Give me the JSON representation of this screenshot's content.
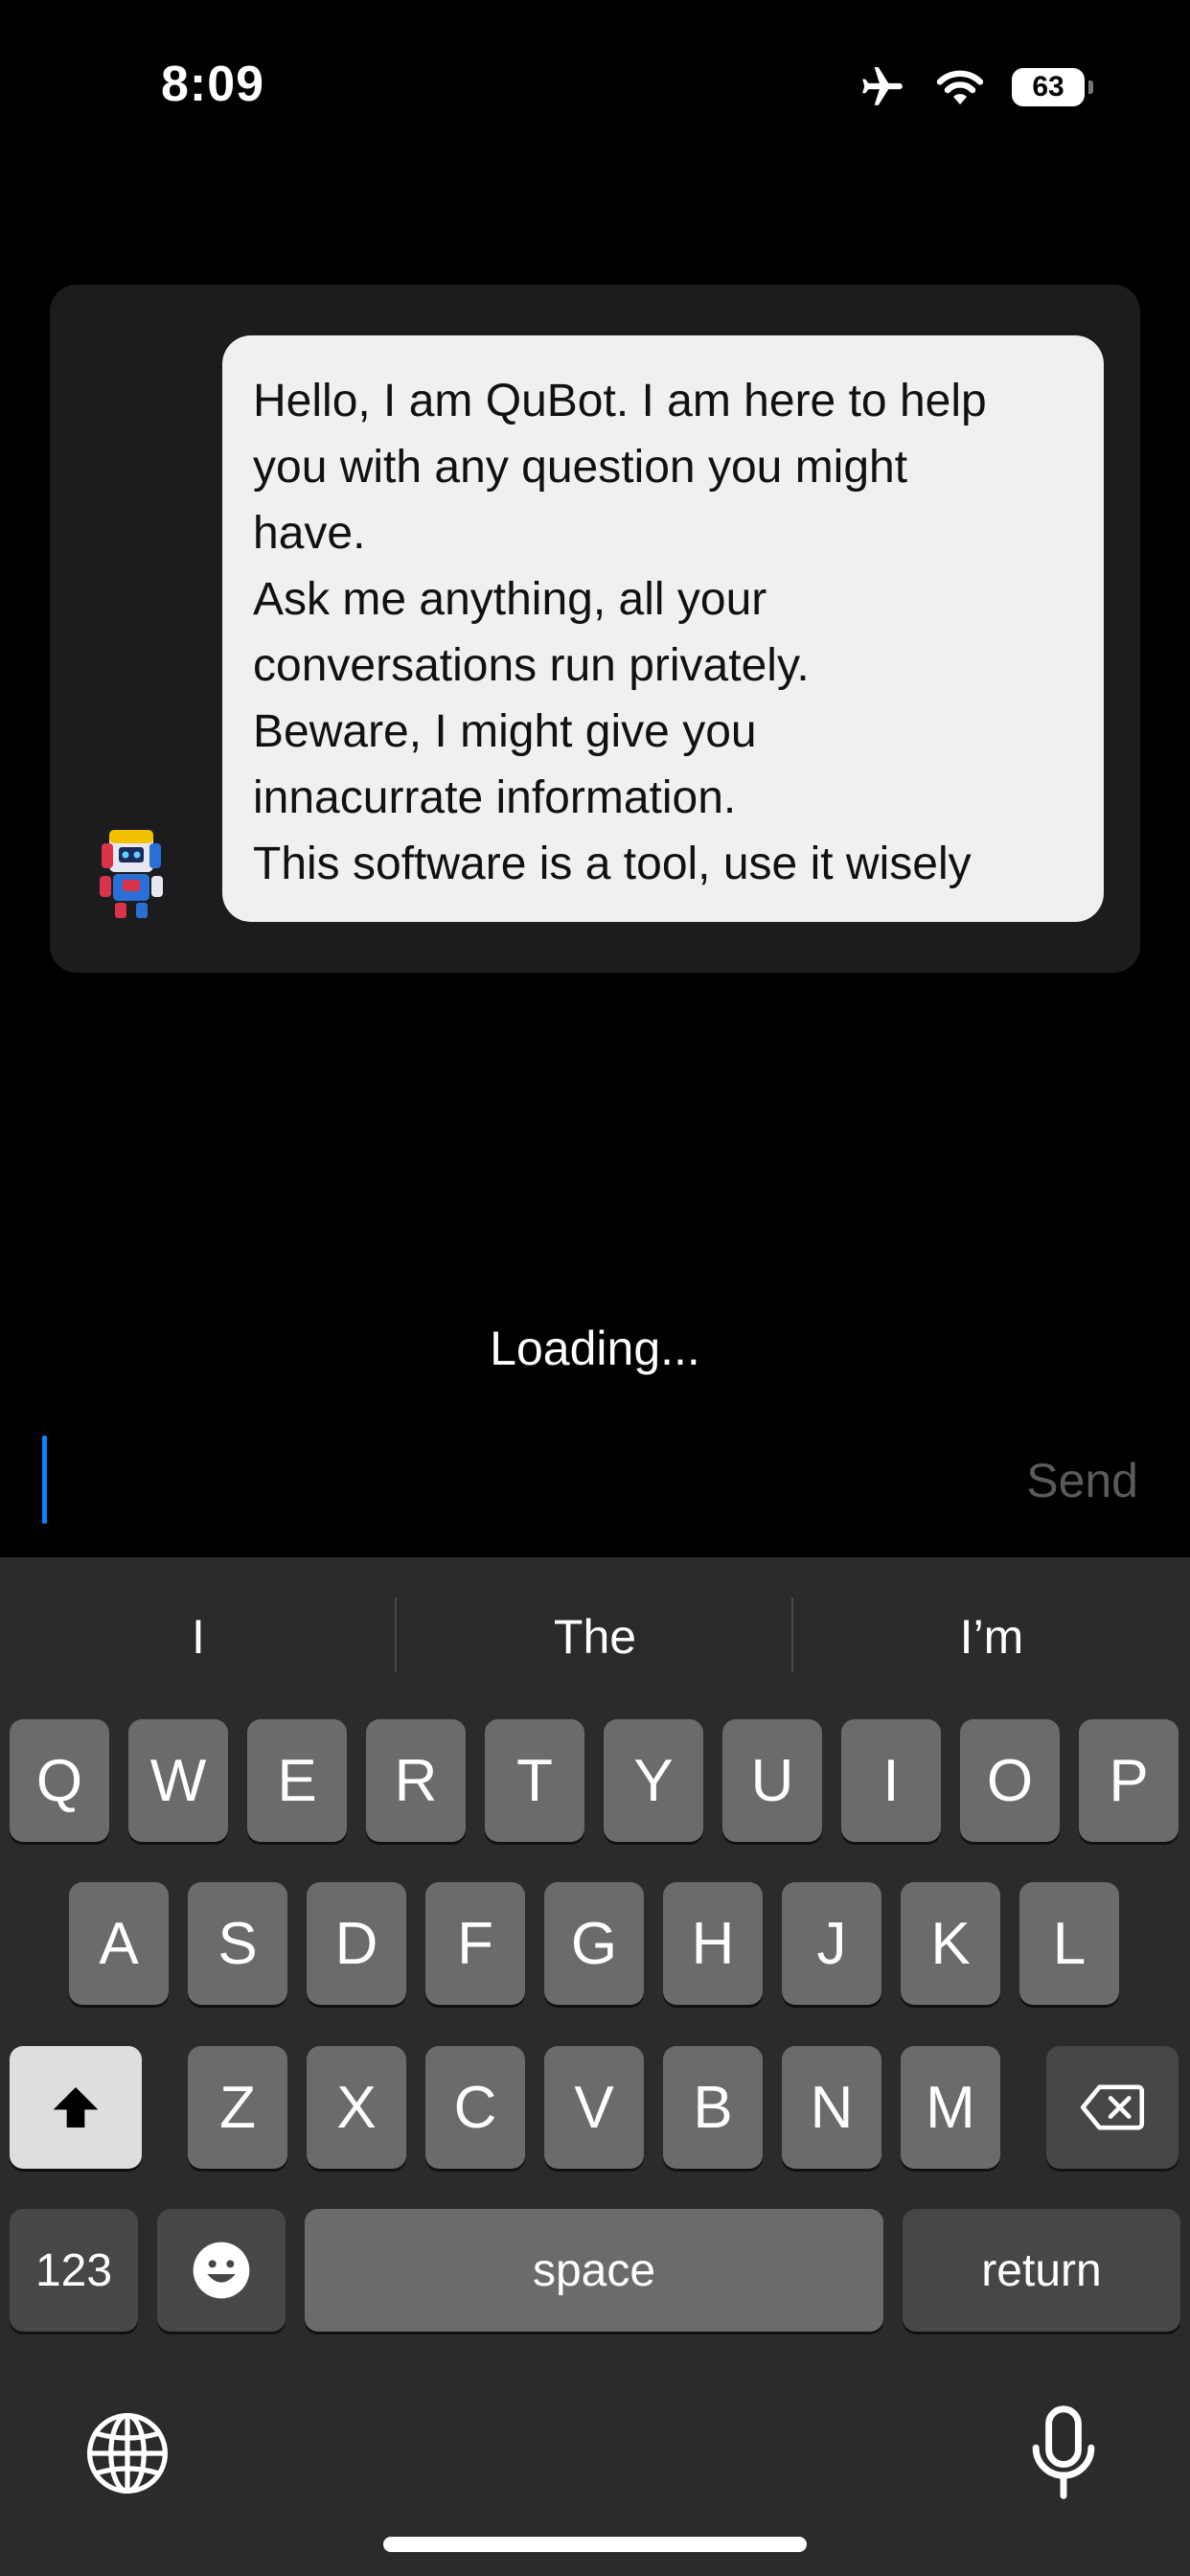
{
  "status_bar": {
    "time": "8:09",
    "battery": "63"
  },
  "chat": {
    "bot_name": "QuBot",
    "message_lines": [
      "Hello, I am QuBot. I am here to help",
      "you with any question you might",
      "have.",
      "Ask me anything, all your",
      "conversations run privately.",
      "Beware, I might give you",
      "innacurrate information.",
      "This software is a tool, use it wisely"
    ]
  },
  "loading_text": "Loading...",
  "input": {
    "value": "",
    "send_label": "Send"
  },
  "keyboard": {
    "suggestions": [
      "I",
      "The",
      "I’m"
    ],
    "row1": [
      "Q",
      "W",
      "E",
      "R",
      "T",
      "Y",
      "U",
      "I",
      "O",
      "P"
    ],
    "row2": [
      "A",
      "S",
      "D",
      "F",
      "G",
      "H",
      "J",
      "K",
      "L"
    ],
    "row3": [
      "Z",
      "X",
      "C",
      "V",
      "B",
      "N",
      "M"
    ],
    "numbers_label": "123",
    "space_label": "space",
    "return_label": "return"
  },
  "colors": {
    "accent": "#0a84ff",
    "bubble": "#f0f0f0",
    "card": "#1c1c1e",
    "keyboard_bg": "#2b2b2d"
  }
}
